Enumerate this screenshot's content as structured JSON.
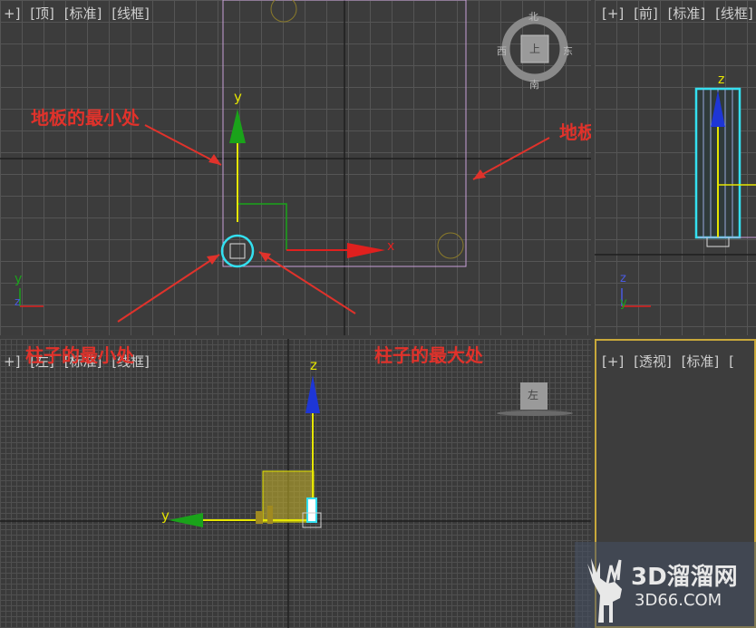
{
  "viewports": {
    "top": {
      "labels": [
        "+]",
        "[顶]",
        "[标准]",
        "[线框]"
      ]
    },
    "front": {
      "labels": [
        "[+]",
        "[前]",
        "[标准]",
        "[线框]"
      ]
    },
    "left": {
      "labels": [
        "+]",
        "[左]",
        "[标准]",
        "[线框]"
      ]
    },
    "perspective": {
      "labels": [
        "[+]",
        "[透视]",
        "[标准]",
        "["
      ]
    }
  },
  "viewcube": {
    "north": "北",
    "south": "南",
    "east": "东",
    "west": "西",
    "top_face": "上",
    "left_face": "左"
  },
  "annotations": {
    "floor_min": "地板的最小处",
    "floor_max": "地板的最大处",
    "pillar_min": "柱子的最小处",
    "pillar_max": "柱子的最大处"
  },
  "axes": {
    "x": "x",
    "y": "y",
    "z": "z"
  },
  "watermark": {
    "main": "3D溜溜网",
    "sub": "3D66.COM"
  },
  "colors": {
    "annotation": "#e0322b",
    "x_axis": "#e0201e",
    "y_axis": "#1aa31a",
    "z_axis": "#1e36d6",
    "gizmo_yellow": "#e6e600",
    "selection_cyan": "#33e0f0"
  }
}
